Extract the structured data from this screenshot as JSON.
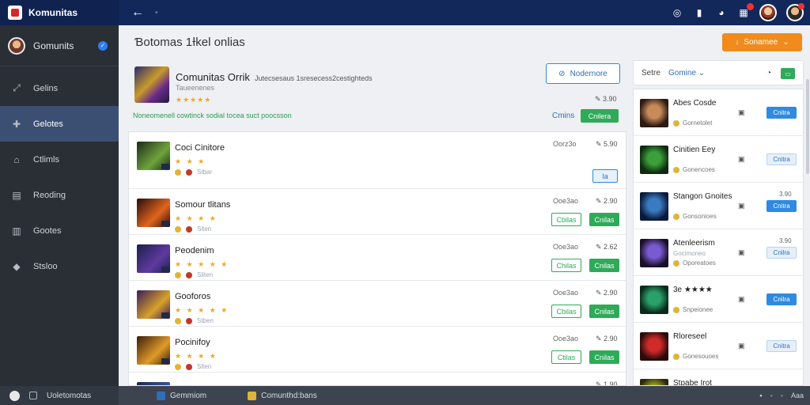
{
  "app": {
    "title": "Komunitas"
  },
  "topbar": {
    "back_label": "←",
    "back_dot": "•"
  },
  "sidebar": {
    "user_name": "Gomunits",
    "items": [
      {
        "label": "Gelins",
        "icon": "expand-icon"
      },
      {
        "label": "Gelotes",
        "icon": "puzzle-icon"
      },
      {
        "label": "Ctlimls",
        "icon": "home-icon"
      },
      {
        "label": "Reoding",
        "icon": "grid-icon"
      },
      {
        "label": "Gootes",
        "icon": "book-icon"
      },
      {
        "label": "Stsloo",
        "icon": "box-icon"
      }
    ]
  },
  "main": {
    "page_title": "Ɓotomas 1Ɨkel onlias",
    "sort_label": "Sonamee",
    "featured": {
      "title": "Comunitas Orrik",
      "description": "Jutecsesaus 1sresecess2cestighteds",
      "subtitle": "Taueenenes",
      "stars": "★★★★★",
      "note": "Noneomenell cowtinck sodial tocea suct poocsson",
      "share_label": "Nodernore",
      "rating": "3.90",
      "link": "Cmins",
      "button": "Cnilera"
    },
    "rows": [
      {
        "title": "Coci Cinitore",
        "stars": "★ ★ ★",
        "tag": "Stbar",
        "code": "Oorz3o",
        "rate": "5.90",
        "out": "",
        "btn": "",
        "colors": [
          "#1b2a1a",
          "#6fa33c"
        ]
      },
      {
        "title": "Somour tlitans",
        "stars": "★ ★ ★ ★",
        "tag": "Slten",
        "code": "Ooe3ao",
        "rate": "2.90",
        "out": "Cbilas",
        "btn": "Cnilas",
        "colors": [
          "#2a0a0a",
          "#e0661e"
        ]
      },
      {
        "title": "Peodenim",
        "stars": "★ ★ ★ ★ ★",
        "tag": "Sliten",
        "code": "Ooe3ao",
        "rate": "2.62",
        "out": "Chilas",
        "btn": "Cnilas",
        "colors": [
          "#1a1f4a",
          "#5f3aa0"
        ]
      },
      {
        "title": "Gooforos",
        "stars": "★ ★ ★ ★ ★",
        "tag": "Stben",
        "code": "Ooe3ao",
        "rate": "2.90",
        "out": "Cbilas",
        "btn": "Cnilas",
        "colors": [
          "#3a1a5a",
          "#d8a12a"
        ]
      },
      {
        "title": "Pocinifoy",
        "stars": "★ ★ ★ ★",
        "tag": "Slten",
        "code": "Ooe3ao",
        "rate": "2.90",
        "out": "Ctilas",
        "btn": "Cnilas",
        "colors": [
          "#3a1d0a",
          "#e09a2a"
        ]
      },
      {
        "title": "",
        "stars": "",
        "tag": "",
        "code": "",
        "rate": "1.90",
        "out": "",
        "btn": "",
        "colors": [
          "#1a2a4a",
          "#3a5aa0"
        ]
      }
    ],
    "first_row_btn": "Ia"
  },
  "right_panel": {
    "label": "Setre",
    "select": "Gomine ⌄",
    "items": [
      {
        "title": "Abes Cosde",
        "meta": "",
        "sub": "Gornetolet",
        "num": "",
        "btn": "Cnitra",
        "colors": [
          "#2a1a12",
          "#c98a5a"
        ]
      },
      {
        "title": "Cinitien Eey",
        "meta": "",
        "sub": "Gonencoes",
        "num": "",
        "btn": "Cnitra",
        "colors": [
          "#0f2a0f",
          "#3aa03a"
        ]
      },
      {
        "title": "Stangon Gnoites",
        "meta": "",
        "sub": "Gonsonioes",
        "num": "3.90",
        "btn": "Cnitra",
        "colors": [
          "#0a1a3a",
          "#3a7ac0"
        ]
      },
      {
        "title": "Atenleerism",
        "meta": "Gocimoneo",
        "sub": "Oporeatoes",
        "num": "3.90",
        "btn": "Cnilra",
        "colors": [
          "#1a0f2a",
          "#7a5ad0"
        ]
      },
      {
        "title": "3e ★★★★",
        "meta": "",
        "sub": "Snpeionee",
        "num": "",
        "btn": "Cnilra",
        "colors": [
          "#0a2a1a",
          "#2aa06a"
        ]
      },
      {
        "title": "Rloreseel",
        "meta": "",
        "sub": "Gonesouoes",
        "num": "",
        "btn": "Cnitra",
        "colors": [
          "#2a0a0a",
          "#d02a2a"
        ]
      },
      {
        "title": "Stpabe Irot",
        "meta": "",
        "sub": "",
        "num": "",
        "btn": "",
        "colors": [
          "#2a2a0a",
          "#a0a02a"
        ]
      }
    ]
  },
  "bottombar": {
    "start_label": "Uoletomotas",
    "task1": "Gemmiom",
    "task2": "Comunthd:bans",
    "tray": "Aaa"
  },
  "colors": {
    "accent": "#2eaa58",
    "brand": "#12285a",
    "primary": "#2f8ae0",
    "warn": "#f08b1c"
  }
}
